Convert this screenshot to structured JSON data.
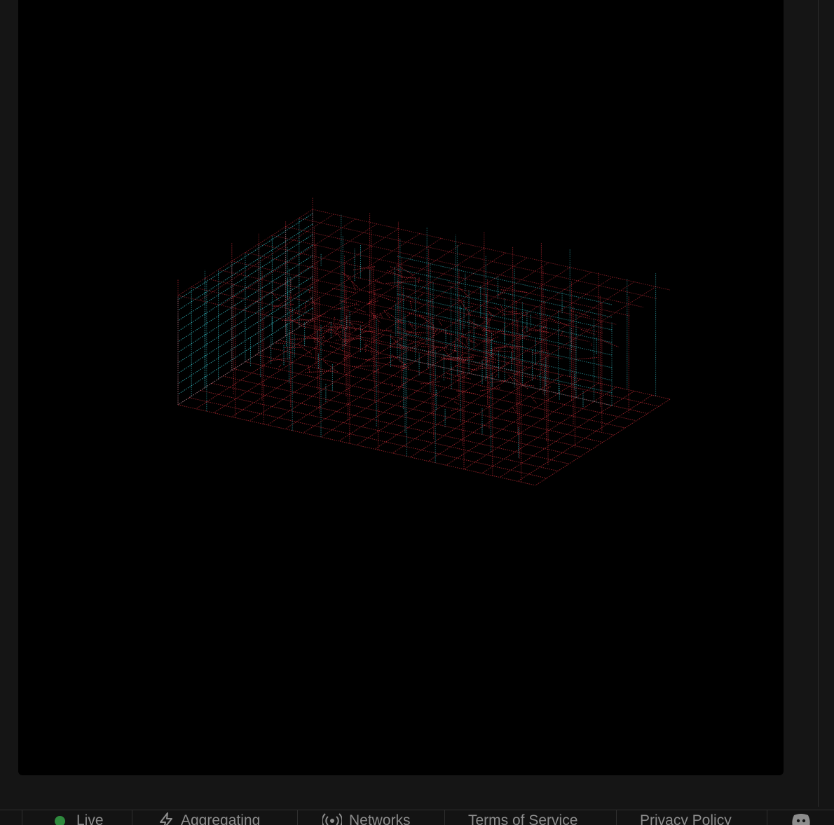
{
  "footer": {
    "live_label": "Live",
    "aggregating_label": "Aggregating",
    "networks_label": "Networks",
    "terms_label": "Terms of Service",
    "privacy_label": "Privacy Policy"
  },
  "icons": {
    "live": "status-dot",
    "aggregating": "lightning-bolt-icon",
    "networks": "broadcast-icon",
    "discord": "discord-icon"
  },
  "colors": {
    "background": "#151515",
    "viewer_background": "#000000",
    "point_red": "#ff3a46",
    "point_cyan": "#3ad7e0",
    "live_green": "#2f8a3e",
    "footer_text": "#8d8d8d"
  }
}
